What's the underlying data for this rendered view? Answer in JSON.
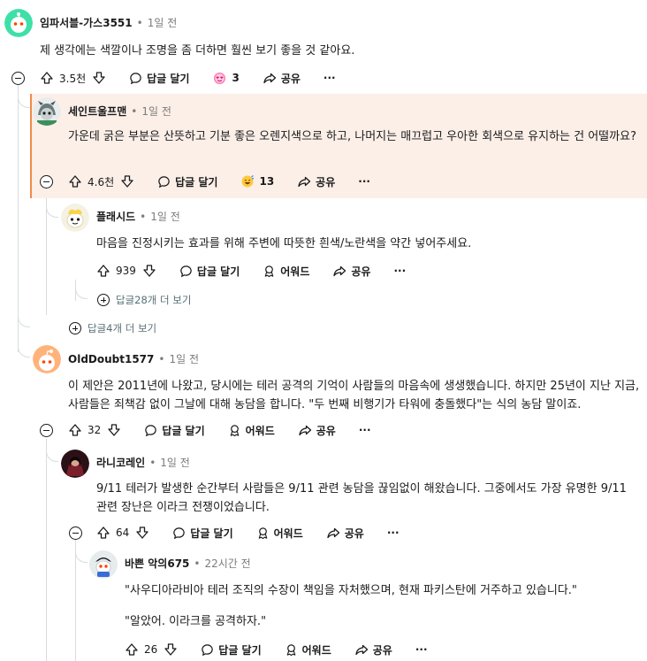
{
  "labels": {
    "reply": "답글 달기",
    "share": "공유",
    "award": "어워드",
    "more": "···"
  },
  "comments": [
    {
      "username": "임파서블-가스3551",
      "time": "1일 전",
      "body": "제 생각에는 색깔이나 조명을 좀 더하면 훨씬 보기 좋을 것 같아요.",
      "votes": "3.5천",
      "award_count": "3"
    },
    {
      "username": "세인트울프맨",
      "time": "1일 전",
      "body": "가운데 굵은 부분은 산뜻하고 기분 좋은 오렌지색으로 하고, 나머지는 매끄럽고 우아한 회색으로 유지하는 건 어떨까요?",
      "votes": "4.6천",
      "award_count": "13"
    },
    {
      "username": "플래시드",
      "time": "1일 전",
      "body": "마음을 진정시키는 효과를 위해 주변에 따뜻한 흰색/노란색을 약간 넣어주세요.",
      "votes": "939"
    },
    {
      "username": "OldDoubt1577",
      "time": "1일 전",
      "body": "이 제안은 2011년에 나왔고, 당시에는 테러 공격의 기억이 사람들의 마음속에 생생했습니다. 하지만 25년이 지난 지금, 사람들은 죄책감 없이 그날에 대해 농담을 합니다. \"두 번째 비행기가 타워에 충돌했다\"는 식의 농담 말이죠.",
      "votes": "32"
    },
    {
      "username": "라니코레인",
      "time": "1일 전",
      "body": "9/11 테러가 발생한 순간부터 사람들은 9/11 관련 농담을 끊임없이 해왔습니다. 그중에서도 가장 유명한 9/11 관련 장난은 이라크 전쟁이었습니다.",
      "votes": "64"
    },
    {
      "username": "바쁜 악의675",
      "time": "22시간 전",
      "body": "\"사우디아라비아 테러 조직의 수장이 책임을 자처했으며, 현재 파키스탄에 거주하고 있습니다.\"",
      "body2": "\"알았어. 이라크를 공격하자.\"",
      "votes": "26"
    }
  ],
  "more_replies": {
    "first": "답글28개 더 보기",
    "second": "답글4개 더 보기"
  }
}
